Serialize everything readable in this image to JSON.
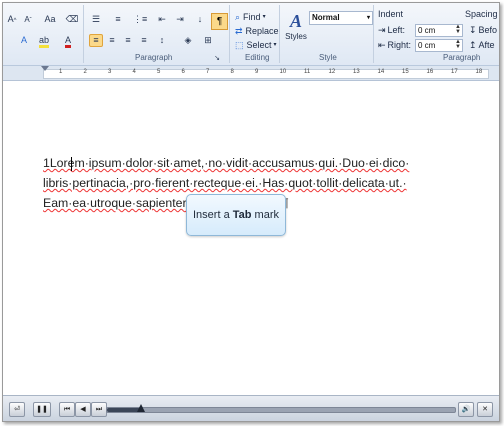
{
  "ribbon": {
    "font_group": {
      "grow_font": "A",
      "shrink_font": "A",
      "change_case": "Aa"
    },
    "paragraph_label": "Paragraph",
    "editing": {
      "label": "Editing",
      "find": "Find",
      "replace": "Replace",
      "select": "Select"
    },
    "style": {
      "label": "Style",
      "styles_button": "Styles",
      "current_style": "Normal"
    },
    "indent": {
      "title": "Indent",
      "left_label": "Left:",
      "left_value": "0 cm",
      "right_label": "Right:",
      "right_value": "0 cm"
    },
    "spacing": {
      "title": "Spacing",
      "before_label": "Befo",
      "after_label": "Afte"
    },
    "paragraph_label_2": "Paragraph",
    "pilcrow": "¶"
  },
  "ruler": {
    "numbers": [
      "1",
      "2",
      "3",
      "4",
      "5",
      "6",
      "7",
      "8",
      "9",
      "10",
      "11",
      "12",
      "13",
      "14",
      "15",
      "16",
      "17",
      "18"
    ]
  },
  "document": {
    "line1": "1Lorem·ipsum·dolor·sit·amet,·no·vidit·accusamus·qui.·Duo·ei·dico·",
    "line2": "libris·pertinacia,·pro·fierent·recteque·ei.·Has·quot·tollit·delicata·ut.·",
    "line3_start": "Eam·ea·utroque·sapienter",
    "line3_end": ".¶"
  },
  "tooltip": {
    "prefix": "Insert a ",
    "bold": "Tab",
    "suffix": " mark"
  },
  "player": {
    "progress": 0.1
  }
}
